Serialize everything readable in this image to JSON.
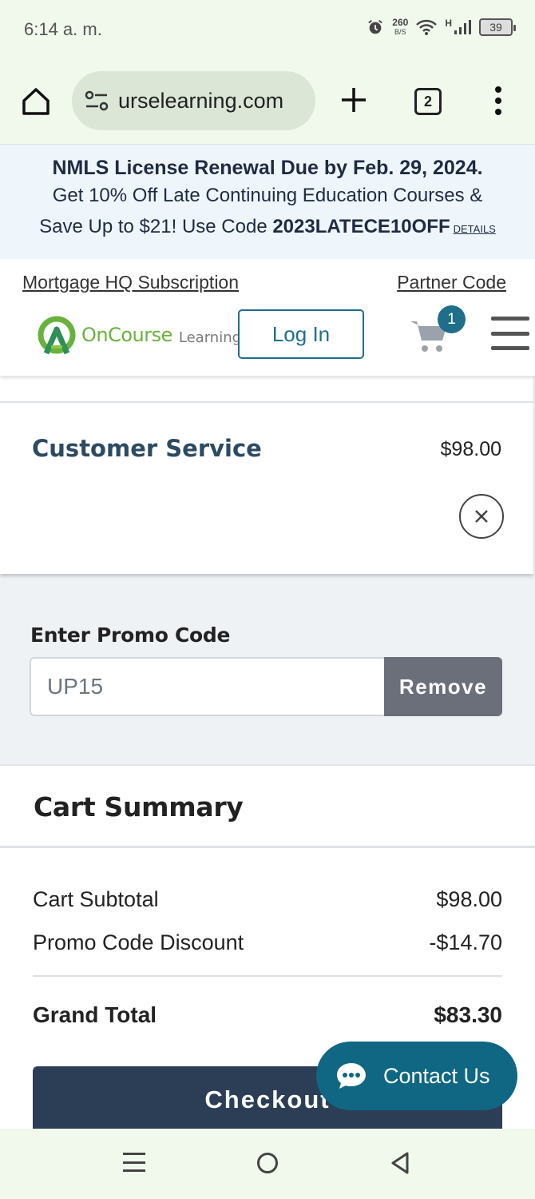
{
  "status_bar": {
    "time": "6:14 a. m.",
    "net_speed_value": "260",
    "net_speed_unit": "B/S",
    "signal_label": "H",
    "battery": "39"
  },
  "browser": {
    "url": "urselearning.com",
    "tab_count": "2"
  },
  "announcement": {
    "title": "NMLS License Renewal Due by Feb. 29, 2024.",
    "line1": "Get 10% Off Late Continuing Education Courses &",
    "line2_prefix": "Save Up to $21! Use Code ",
    "code": "2023LATECE10OFF",
    "details_link": "DETAILS"
  },
  "header": {
    "left_link": "Mortgage HQ Subscription",
    "right_link": "Partner Code",
    "logo_brand": "OnCourse",
    "logo_sub": "Learning",
    "login_label": "Log In",
    "cart_count": "1"
  },
  "cart_item": {
    "name": "Customer Service",
    "price": "$98.00"
  },
  "promo": {
    "label": "Enter Promo Code",
    "value": "UP15",
    "remove_label": "Remove"
  },
  "summary": {
    "title": "Cart Summary",
    "subtotal_label": "Cart Subtotal",
    "subtotal_value": "$98.00",
    "discount_label": "Promo Code Discount",
    "discount_value": "-$14.70",
    "grand_label": "Grand Total",
    "grand_value": "$83.30",
    "checkout_label": "Checkout"
  },
  "contact": {
    "label": "Contact Us"
  },
  "colors": {
    "brand_teal": "#1f6f8b",
    "checkout_navy": "#2c3e55",
    "logo_green": "#6ab23e"
  }
}
